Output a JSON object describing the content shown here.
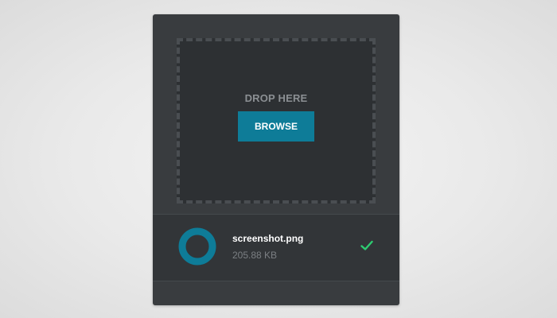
{
  "uploader": {
    "drop_label": "DROP HERE",
    "browse_label": "BROWSE",
    "accent_color": "#0e7c98",
    "success_color": "#2ecc71"
  },
  "file": {
    "name": "screenshot.png",
    "size": "205.88 KB",
    "progress": 1.0,
    "status_icon": "check-icon",
    "file_icon": "progress-ring-icon"
  }
}
